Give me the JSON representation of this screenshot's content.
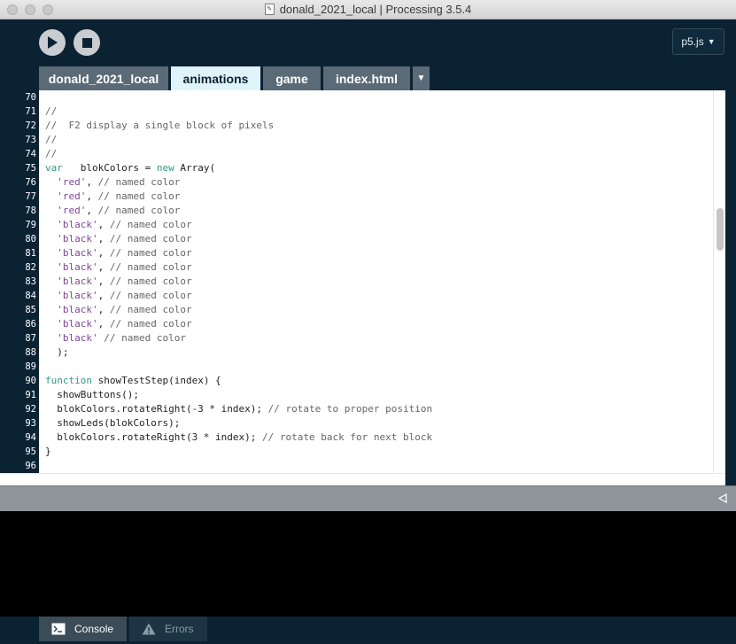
{
  "window": {
    "title": "donald_2021_local | Processing 3.5.4"
  },
  "toolbar": {
    "run_icon": "play-icon",
    "stop_icon": "stop-icon",
    "mode_label": "p5.js",
    "mode_arrow": "▼"
  },
  "tabs": [
    {
      "label": "donald_2021_local"
    },
    {
      "label": "animations"
    },
    {
      "label": "game"
    },
    {
      "label": "index.html"
    }
  ],
  "tab_menu_glyph": "▼",
  "editor": {
    "lines": [
      {
        "n": "70",
        "parts": []
      },
      {
        "n": "71",
        "parts": [
          [
            "cm",
            "//"
          ]
        ]
      },
      {
        "n": "72",
        "parts": [
          [
            "cm",
            "//  F2 display a single block of pixels"
          ]
        ]
      },
      {
        "n": "73",
        "parts": [
          [
            "cm",
            "//"
          ]
        ]
      },
      {
        "n": "74",
        "parts": [
          [
            "cm",
            "//"
          ]
        ]
      },
      {
        "n": "75",
        "parts": [
          [
            "kw",
            "var"
          ],
          [
            "pl",
            "   blokColors = "
          ],
          [
            "kw",
            "new"
          ],
          [
            "pl",
            " Array("
          ]
        ]
      },
      {
        "n": "76",
        "parts": [
          [
            "pl",
            "  "
          ],
          [
            "st",
            "'red'"
          ],
          [
            "pl",
            ", "
          ],
          [
            "cm",
            "// named color"
          ]
        ]
      },
      {
        "n": "77",
        "parts": [
          [
            "pl",
            "  "
          ],
          [
            "st",
            "'red'"
          ],
          [
            "pl",
            ", "
          ],
          [
            "cm",
            "// named color"
          ]
        ]
      },
      {
        "n": "78",
        "parts": [
          [
            "pl",
            "  "
          ],
          [
            "st",
            "'red'"
          ],
          [
            "pl",
            ", "
          ],
          [
            "cm",
            "// named color"
          ]
        ]
      },
      {
        "n": "79",
        "parts": [
          [
            "pl",
            "  "
          ],
          [
            "st",
            "'black'"
          ],
          [
            "pl",
            ", "
          ],
          [
            "cm",
            "// named color"
          ]
        ]
      },
      {
        "n": "80",
        "parts": [
          [
            "pl",
            "  "
          ],
          [
            "st",
            "'black'"
          ],
          [
            "pl",
            ", "
          ],
          [
            "cm",
            "// named color"
          ]
        ]
      },
      {
        "n": "81",
        "parts": [
          [
            "pl",
            "  "
          ],
          [
            "st",
            "'black'"
          ],
          [
            "pl",
            ", "
          ],
          [
            "cm",
            "// named color"
          ]
        ]
      },
      {
        "n": "82",
        "parts": [
          [
            "pl",
            "  "
          ],
          [
            "st",
            "'black'"
          ],
          [
            "pl",
            ", "
          ],
          [
            "cm",
            "// named color"
          ]
        ]
      },
      {
        "n": "83",
        "parts": [
          [
            "pl",
            "  "
          ],
          [
            "st",
            "'black'"
          ],
          [
            "pl",
            ", "
          ],
          [
            "cm",
            "// named color"
          ]
        ]
      },
      {
        "n": "84",
        "parts": [
          [
            "pl",
            "  "
          ],
          [
            "st",
            "'black'"
          ],
          [
            "pl",
            ", "
          ],
          [
            "cm",
            "// named color"
          ]
        ]
      },
      {
        "n": "85",
        "parts": [
          [
            "pl",
            "  "
          ],
          [
            "st",
            "'black'"
          ],
          [
            "pl",
            ", "
          ],
          [
            "cm",
            "// named color"
          ]
        ]
      },
      {
        "n": "86",
        "parts": [
          [
            "pl",
            "  "
          ],
          [
            "st",
            "'black'"
          ],
          [
            "pl",
            ", "
          ],
          [
            "cm",
            "// named color"
          ]
        ]
      },
      {
        "n": "87",
        "parts": [
          [
            "pl",
            "  "
          ],
          [
            "st",
            "'black'"
          ],
          [
            "pl",
            " "
          ],
          [
            "cm",
            "// named color"
          ]
        ]
      },
      {
        "n": "88",
        "parts": [
          [
            "pl",
            "  );"
          ]
        ]
      },
      {
        "n": "89",
        "parts": []
      },
      {
        "n": "90",
        "parts": [
          [
            "kw",
            "function"
          ],
          [
            "pl",
            " showTestStep(index) {"
          ]
        ]
      },
      {
        "n": "91",
        "parts": [
          [
            "pl",
            "  showButtons();"
          ]
        ]
      },
      {
        "n": "92",
        "parts": [
          [
            "pl",
            "  blokColors.rotateRight(-3 * index); "
          ],
          [
            "cm",
            "// rotate to proper position"
          ]
        ]
      },
      {
        "n": "93",
        "parts": [
          [
            "pl",
            "  showLeds(blokColors);"
          ]
        ]
      },
      {
        "n": "94",
        "parts": [
          [
            "pl",
            "  blokColors.rotateRight(3 * index); "
          ],
          [
            "cm",
            "// rotate back for next block"
          ]
        ]
      },
      {
        "n": "95",
        "parts": [
          [
            "pl",
            "}"
          ]
        ]
      },
      {
        "n": "96",
        "parts": []
      }
    ]
  },
  "console_panel": {
    "collapse_icon": "collapse-arrow-icon"
  },
  "bottom_tabs": [
    {
      "label": "Console",
      "icon": "console-icon"
    },
    {
      "label": "Errors",
      "icon": "warning-icon"
    }
  ],
  "colors": {
    "background": "#0b2233",
    "active_tab": "#dff3fb",
    "inactive_tab": "#5a6a76",
    "keyword": "#33997e",
    "string": "#7d4793",
    "comment": "#666666"
  }
}
